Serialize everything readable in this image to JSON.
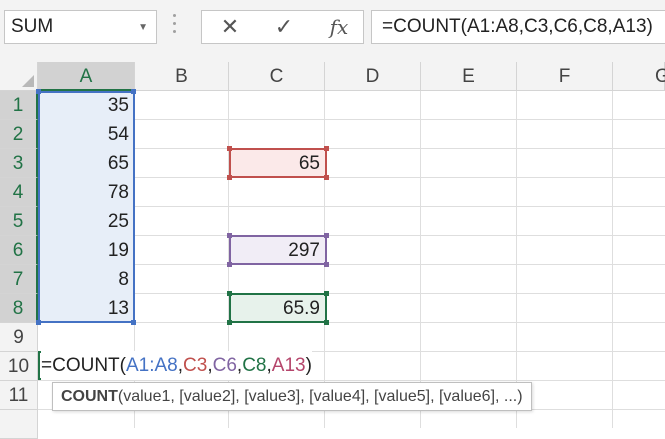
{
  "name_box": {
    "value": "SUM",
    "dropdown_glyph": "▼"
  },
  "formula_buttons": {
    "cancel": "✕",
    "enter": "✓",
    "insert_function": "fx"
  },
  "formula_bar": {
    "value": "=COUNT(A1:A8,C3,C6,C8,A13)"
  },
  "columns": [
    "A",
    "B",
    "C",
    "D",
    "E",
    "F",
    "G"
  ],
  "rows": [
    "1",
    "2",
    "3",
    "4",
    "5",
    "6",
    "7",
    "8",
    "9",
    "10",
    "11"
  ],
  "cells": {
    "A1": "35",
    "A2": "54",
    "A3": "65",
    "A4": "78",
    "A5": "25",
    "A6": "19",
    "A7": "8",
    "A8": "13",
    "C3": "65",
    "C6": "297",
    "C8": "65.9"
  },
  "edit_formula": {
    "eq": "=COUNT(",
    "ref1": "A1:A8",
    "c1": ",",
    "ref2": "C3",
    "c2": ",",
    "ref3": "C6",
    "c3": ",",
    "ref4": "C8",
    "c4": ",",
    "ref5": "A13",
    "close": ")"
  },
  "tooltip": {
    "fn": "COUNT",
    "args": "(value1, [value2], [value3], [value4], [value5], [value6], ...)"
  },
  "ref_colors": {
    "A1_A8": "#4472c4",
    "C3": "#c0504d",
    "C6": "#8064a2",
    "C8": "#217346",
    "A13": "#b5456b"
  }
}
